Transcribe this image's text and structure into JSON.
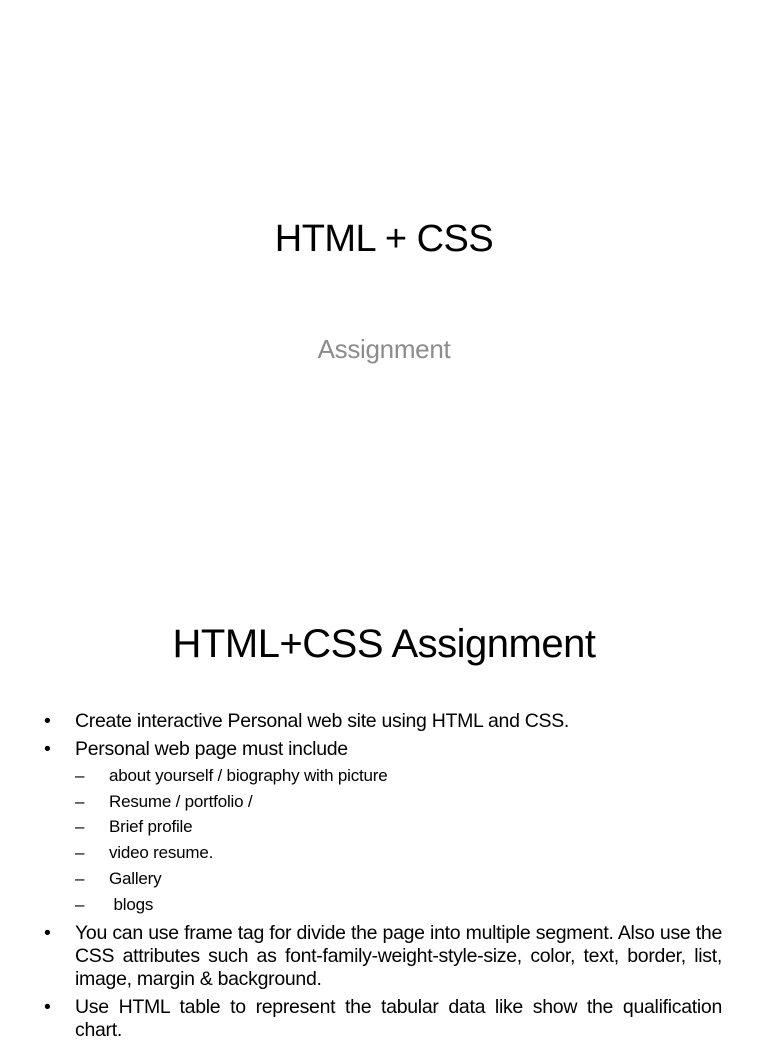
{
  "slide1": {
    "title": "HTML + CSS",
    "subtitle": "Assignment"
  },
  "slide2": {
    "title": "HTML+CSS Assignment",
    "bullet_glyph": "•",
    "dash_glyph": "–",
    "bullets": [
      {
        "text": "Create interactive Personal web site using HTML and CSS."
      },
      {
        "text": "Personal web page must include",
        "sub": [
          "about yourself / biography  with picture",
          "Resume / portfolio /",
          "Brief profile",
          "video resume.",
          "Gallery",
          " blogs"
        ]
      },
      {
        "text": "You can use frame tag for divide the page into multiple segment. Also use the CSS attributes such as font-family-weight-style-size, color, text, border, list, image, margin & background."
      },
      {
        "text": "Use HTML table to represent the tabular data like show the qualification chart."
      }
    ]
  }
}
